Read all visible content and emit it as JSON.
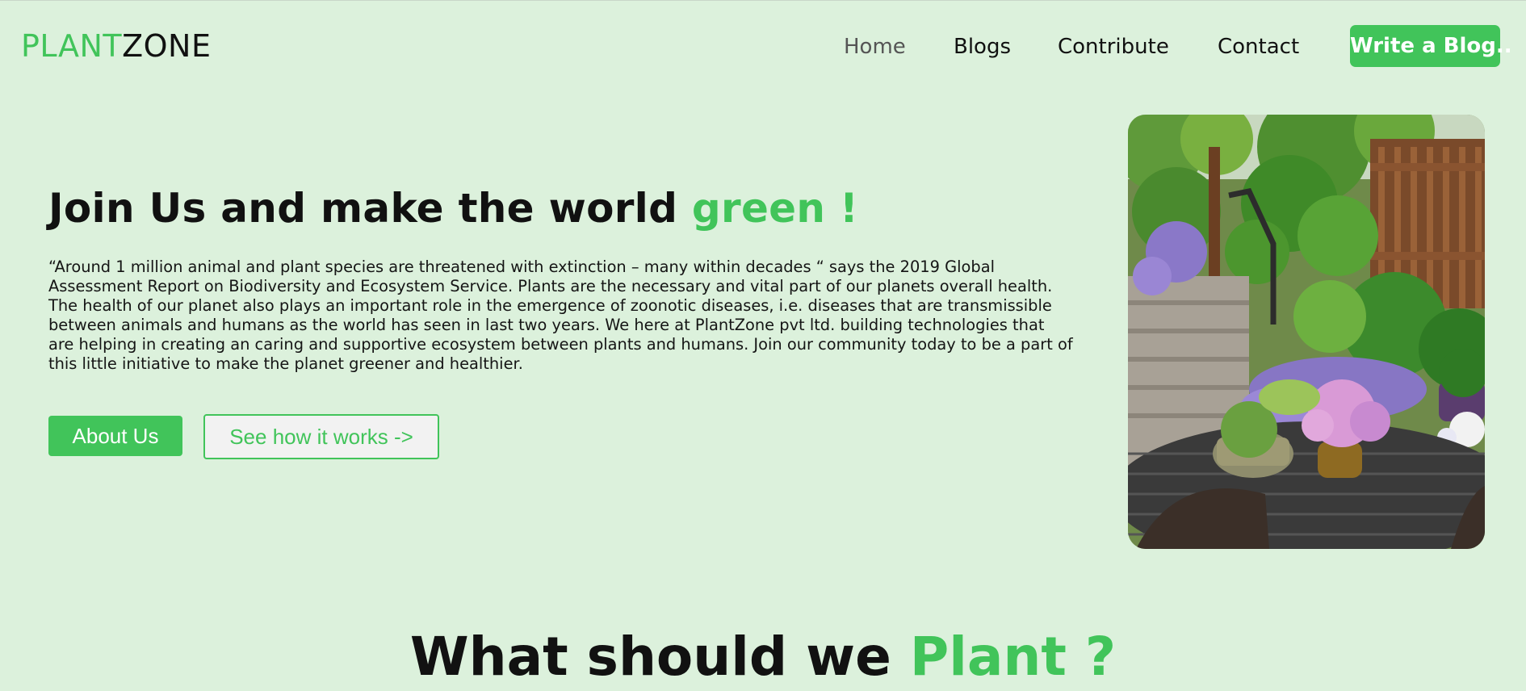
{
  "brand": {
    "part1": "PLANT",
    "part2": "ZONE"
  },
  "nav": {
    "items": [
      {
        "label": "Home",
        "active": true
      },
      {
        "label": "Blogs"
      },
      {
        "label": "Contribute"
      },
      {
        "label": "Contact"
      }
    ],
    "cta_label": "Write a Blog.."
  },
  "hero": {
    "title_main": "Join Us and make the world ",
    "title_accent": "green !",
    "paragraph": "“Around 1 million animal and plant species are threatened with extinction – many within decades “ says the 2019 Global Assessment Report on Biodiversity and Ecosystem Service. Plants are the necessary and vital part of our planets overall health. The health of our planet also plays an important role in the emergence of zoonotic diseases, i.e. diseases that are transmissible between animals and humans as the world has seen in last two years. We here at PlantZone pvt ltd. building technologies that are helping in creating an caring and supportive ecosystem between plants and humans. Join our community today to be a part of this little initiative to make the planet greener and healthier.",
    "about_label": "About Us",
    "how_label": "See how it works ->"
  },
  "section": {
    "title_main": "What should we ",
    "title_accent": "Plant ?"
  },
  "colors": {
    "background": "#dcf1dc",
    "accent": "#41c45a",
    "text": "#111111"
  }
}
